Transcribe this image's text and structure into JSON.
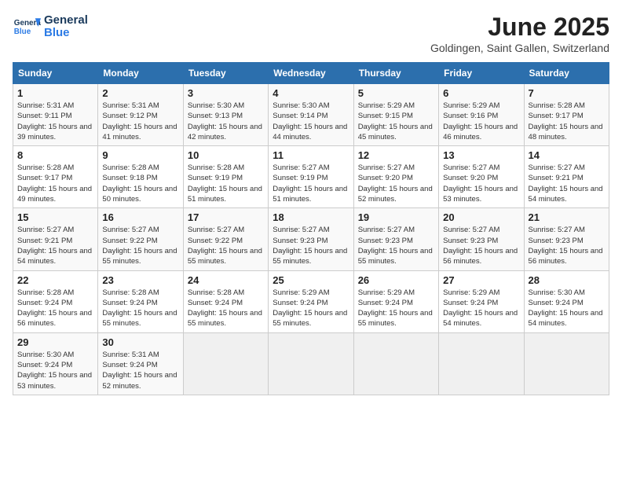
{
  "logo": {
    "line1": "General",
    "line2": "Blue"
  },
  "title": "June 2025",
  "location": "Goldingen, Saint Gallen, Switzerland",
  "weekdays": [
    "Sunday",
    "Monday",
    "Tuesday",
    "Wednesday",
    "Thursday",
    "Friday",
    "Saturday"
  ],
  "weeks": [
    [
      {
        "day": "1",
        "sunrise": "5:31 AM",
        "sunset": "9:11 PM",
        "daylight": "15 hours and 39 minutes."
      },
      {
        "day": "2",
        "sunrise": "5:31 AM",
        "sunset": "9:12 PM",
        "daylight": "15 hours and 41 minutes."
      },
      {
        "day": "3",
        "sunrise": "5:30 AM",
        "sunset": "9:13 PM",
        "daylight": "15 hours and 42 minutes."
      },
      {
        "day": "4",
        "sunrise": "5:30 AM",
        "sunset": "9:14 PM",
        "daylight": "15 hours and 44 minutes."
      },
      {
        "day": "5",
        "sunrise": "5:29 AM",
        "sunset": "9:15 PM",
        "daylight": "15 hours and 45 minutes."
      },
      {
        "day": "6",
        "sunrise": "5:29 AM",
        "sunset": "9:16 PM",
        "daylight": "15 hours and 46 minutes."
      },
      {
        "day": "7",
        "sunrise": "5:28 AM",
        "sunset": "9:17 PM",
        "daylight": "15 hours and 48 minutes."
      }
    ],
    [
      {
        "day": "8",
        "sunrise": "5:28 AM",
        "sunset": "9:17 PM",
        "daylight": "15 hours and 49 minutes."
      },
      {
        "day": "9",
        "sunrise": "5:28 AM",
        "sunset": "9:18 PM",
        "daylight": "15 hours and 50 minutes."
      },
      {
        "day": "10",
        "sunrise": "5:28 AM",
        "sunset": "9:19 PM",
        "daylight": "15 hours and 51 minutes."
      },
      {
        "day": "11",
        "sunrise": "5:27 AM",
        "sunset": "9:19 PM",
        "daylight": "15 hours and 51 minutes."
      },
      {
        "day": "12",
        "sunrise": "5:27 AM",
        "sunset": "9:20 PM",
        "daylight": "15 hours and 52 minutes."
      },
      {
        "day": "13",
        "sunrise": "5:27 AM",
        "sunset": "9:20 PM",
        "daylight": "15 hours and 53 minutes."
      },
      {
        "day": "14",
        "sunrise": "5:27 AM",
        "sunset": "9:21 PM",
        "daylight": "15 hours and 54 minutes."
      }
    ],
    [
      {
        "day": "15",
        "sunrise": "5:27 AM",
        "sunset": "9:21 PM",
        "daylight": "15 hours and 54 minutes."
      },
      {
        "day": "16",
        "sunrise": "5:27 AM",
        "sunset": "9:22 PM",
        "daylight": "15 hours and 55 minutes."
      },
      {
        "day": "17",
        "sunrise": "5:27 AM",
        "sunset": "9:22 PM",
        "daylight": "15 hours and 55 minutes."
      },
      {
        "day": "18",
        "sunrise": "5:27 AM",
        "sunset": "9:23 PM",
        "daylight": "15 hours and 55 minutes."
      },
      {
        "day": "19",
        "sunrise": "5:27 AM",
        "sunset": "9:23 PM",
        "daylight": "15 hours and 55 minutes."
      },
      {
        "day": "20",
        "sunrise": "5:27 AM",
        "sunset": "9:23 PM",
        "daylight": "15 hours and 56 minutes."
      },
      {
        "day": "21",
        "sunrise": "5:27 AM",
        "sunset": "9:23 PM",
        "daylight": "15 hours and 56 minutes."
      }
    ],
    [
      {
        "day": "22",
        "sunrise": "5:28 AM",
        "sunset": "9:24 PM",
        "daylight": "15 hours and 56 minutes."
      },
      {
        "day": "23",
        "sunrise": "5:28 AM",
        "sunset": "9:24 PM",
        "daylight": "15 hours and 55 minutes."
      },
      {
        "day": "24",
        "sunrise": "5:28 AM",
        "sunset": "9:24 PM",
        "daylight": "15 hours and 55 minutes."
      },
      {
        "day": "25",
        "sunrise": "5:29 AM",
        "sunset": "9:24 PM",
        "daylight": "15 hours and 55 minutes."
      },
      {
        "day": "26",
        "sunrise": "5:29 AM",
        "sunset": "9:24 PM",
        "daylight": "15 hours and 55 minutes."
      },
      {
        "day": "27",
        "sunrise": "5:29 AM",
        "sunset": "9:24 PM",
        "daylight": "15 hours and 54 minutes."
      },
      {
        "day": "28",
        "sunrise": "5:30 AM",
        "sunset": "9:24 PM",
        "daylight": "15 hours and 54 minutes."
      }
    ],
    [
      {
        "day": "29",
        "sunrise": "5:30 AM",
        "sunset": "9:24 PM",
        "daylight": "15 hours and 53 minutes."
      },
      {
        "day": "30",
        "sunrise": "5:31 AM",
        "sunset": "9:24 PM",
        "daylight": "15 hours and 52 minutes."
      },
      null,
      null,
      null,
      null,
      null
    ]
  ]
}
